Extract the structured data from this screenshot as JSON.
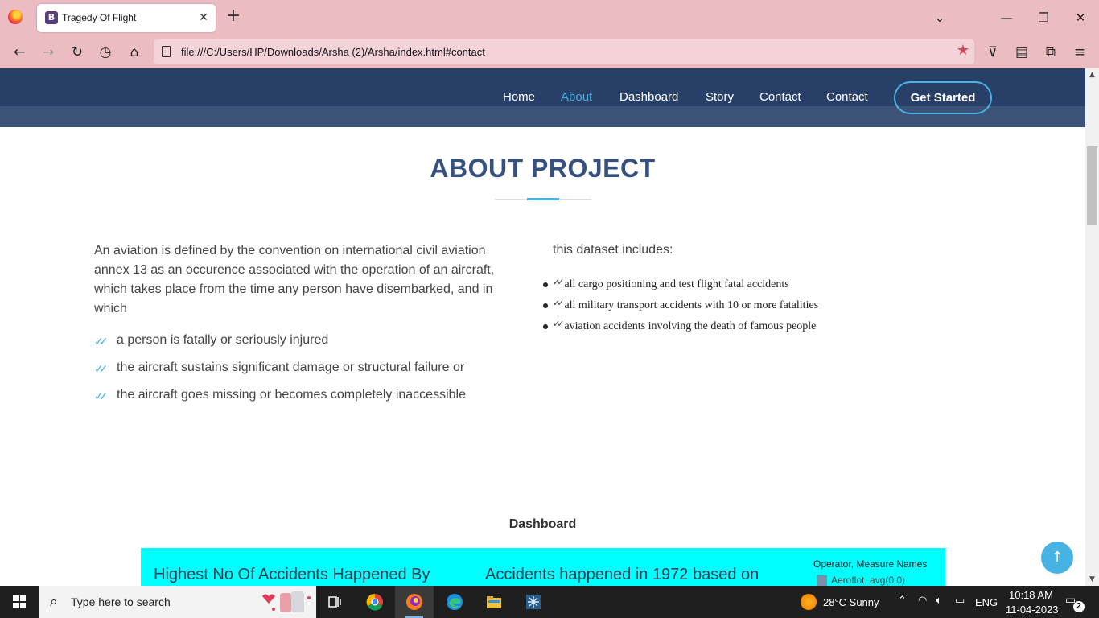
{
  "browser": {
    "tab_title": "Tragedy Of Flight",
    "tab_icon_letter": "B",
    "tab_close": "✕",
    "new_tab": "+",
    "url": "file:///C:/Users/HP/Downloads/Arsha (2)/Arsha/index.html#contact"
  },
  "site_nav": {
    "items": [
      "Home",
      "About",
      "Dashboard",
      "Story",
      "Contact",
      "Contact"
    ],
    "active": "About",
    "cta": "Get Started"
  },
  "about": {
    "title": "ABOUT PROJECT",
    "intro": "An aviation is defined by the convention on international civil aviation annex 13 as an occurence associated with the operation of an aircraft, which takes place from the time any person have disembarked, and in which",
    "checks": [
      "a person is fatally or seriously injured",
      "the aircraft sustains significant damage or structural failure or",
      "the aircraft goes missing or becomes completely inaccessible"
    ],
    "dataset_intro": "this dataset includes:",
    "dataset_items": [
      "all cargo positioning and test flight fatal accidents",
      "all military transport accidents with 10 or more fatalities",
      "aviation accidents involving the death of famous people"
    ]
  },
  "dashboard": {
    "heading": "Dashboard",
    "chart1_title": "Highest No Of Accidents Happened By",
    "chart2_title": "Accidents happened in 1972 based on",
    "legend_title": "Operator, Measure Names",
    "legend_item": "Aeroflot, avg(0.0)"
  },
  "taskbar": {
    "search_placeholder": "Type here to search",
    "weather": "28°C  Sunny",
    "language": "ENG",
    "time": "10:18 AM",
    "date": "11-04-2023",
    "notification_count": "2"
  },
  "colors": {
    "chrome_bg": "#ecbcc3",
    "header_bg": "#283f67",
    "accent": "#47b2e4",
    "title": "#37517e",
    "dash_panel": "#00ffff"
  }
}
